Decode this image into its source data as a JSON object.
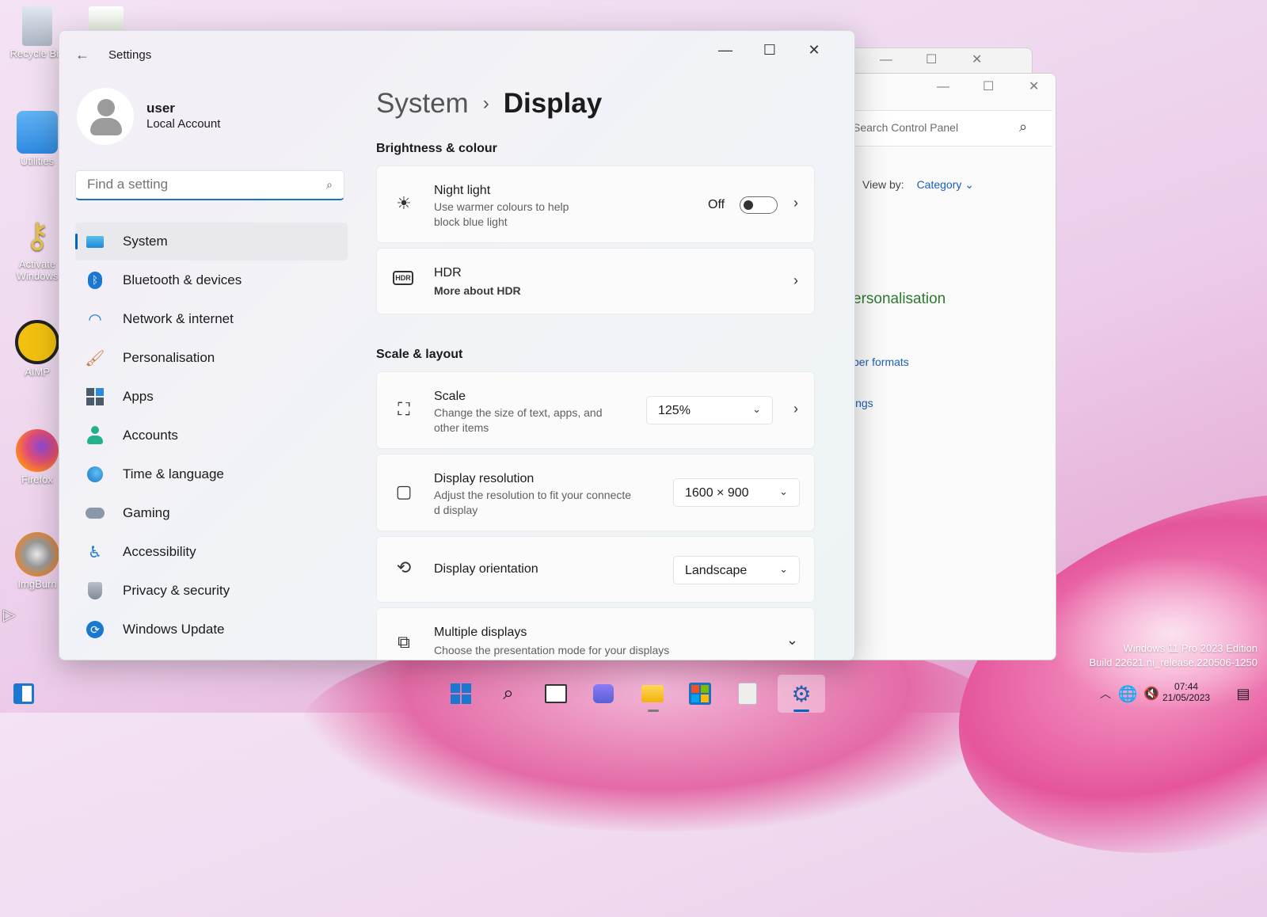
{
  "desktop": {
    "icons": [
      {
        "label": "Recycle Bin"
      },
      {
        "label": "Utilities"
      },
      {
        "label": "Activate Windows"
      },
      {
        "label": "AIMP"
      },
      {
        "label": "Firefox"
      },
      {
        "label": "ImgBurn"
      }
    ],
    "watermark": {
      "line1": "Windows 11 Pro 2023 Edition",
      "line2": "Build 22621.ni_release.220506-1250"
    }
  },
  "control_panel": {
    "search_placeholder": "Search Control Panel",
    "view_by_label": "View by:",
    "view_by_value": "Category",
    "personalisation_fragment": "ersonalisation",
    "number_formats_fragment": "ber formats",
    "settings_fragment": "ings"
  },
  "settings": {
    "app_title": "Settings",
    "user": {
      "name": "user",
      "account_type": "Local Account"
    },
    "search": {
      "placeholder": "Find a setting"
    },
    "nav": [
      {
        "label": "System",
        "icon": "system-icon",
        "active": true
      },
      {
        "label": "Bluetooth & devices",
        "icon": "bluetooth-icon"
      },
      {
        "label": "Network & internet",
        "icon": "wifi-icon"
      },
      {
        "label": "Personalisation",
        "icon": "brush-icon"
      },
      {
        "label": "Apps",
        "icon": "apps-icon"
      },
      {
        "label": "Accounts",
        "icon": "accounts-icon"
      },
      {
        "label": "Time & language",
        "icon": "clock-globe-icon"
      },
      {
        "label": "Gaming",
        "icon": "gamepad-icon"
      },
      {
        "label": "Accessibility",
        "icon": "accessibility-icon"
      },
      {
        "label": "Privacy & security",
        "icon": "shield-icon"
      },
      {
        "label": "Windows Update",
        "icon": "refresh-icon"
      }
    ],
    "breadcrumb": {
      "parent": "System",
      "separator": "›",
      "current": "Display"
    },
    "brightness_section": "Brightness & colour",
    "night_light": {
      "title": "Night light",
      "subtitle_line1": "Use warmer colours to help",
      "subtitle_line2": "block blue light",
      "state": "Off"
    },
    "hdr": {
      "title": "HDR",
      "subtitle": "More about HDR"
    },
    "scale_section": "Scale & layout",
    "scale": {
      "title": "Scale",
      "subtitle_line1": "Change the size of text, apps, and",
      "subtitle_line2": "other items",
      "value": "125%"
    },
    "resolution": {
      "title": "Display resolution",
      "subtitle_line1": "Adjust the resolution to fit your connecte",
      "subtitle_line2": "d display",
      "value": "1600 × 900"
    },
    "orientation": {
      "title": "Display orientation",
      "value": "Landscape"
    },
    "multiple": {
      "title": "Multiple displays",
      "subtitle": "Choose the presentation mode for your displays"
    }
  },
  "taskbar": {
    "clock_time": "07:44",
    "clock_date": "21/05/2023"
  },
  "colors": {
    "accent": "#0067c0",
    "toggle_off": "#333333"
  }
}
